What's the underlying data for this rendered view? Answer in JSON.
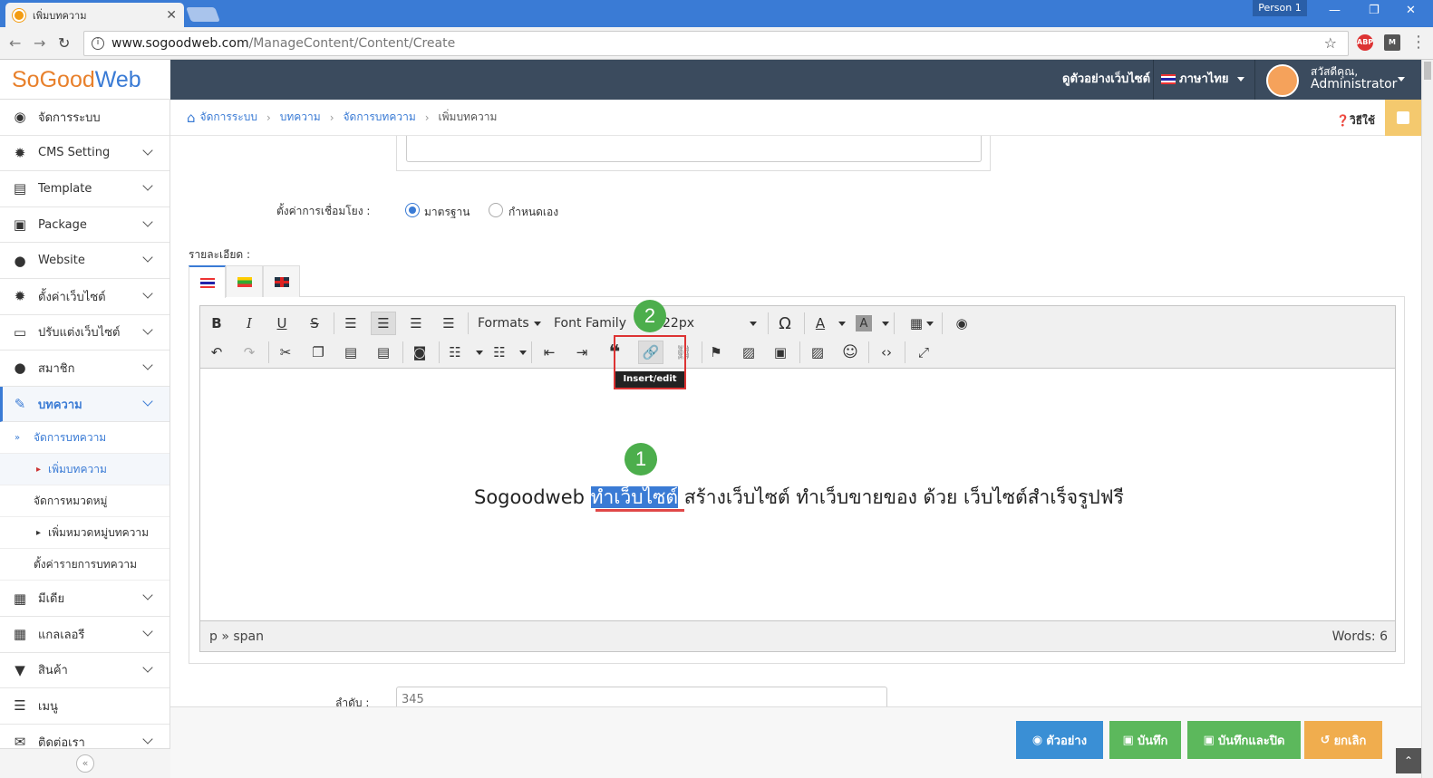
{
  "browser": {
    "tab_title": "เพิ่มบทความ",
    "person": "Person 1",
    "url_host": "www.sogoodweb.com",
    "url_path": "/ManageContent/Content/Create",
    "ext_abp": "ABP",
    "ext_m": "M"
  },
  "brand": {
    "part1": "SoGo",
    "part2": "od",
    "part3": "Web"
  },
  "header": {
    "preview_site": "ดูตัวอย่างเว็บไซต์",
    "language": "ภาษาไทย",
    "greeting": "สวัสดีคุณ,",
    "username": "Administrator"
  },
  "sidebar": {
    "items": [
      {
        "label": "จัดการระบบ",
        "icon": "dashboard-icon"
      },
      {
        "label": "CMS Setting",
        "icon": "gear-icon"
      },
      {
        "label": "Template",
        "icon": "template-icon"
      },
      {
        "label": "Package",
        "icon": "gift-icon"
      },
      {
        "label": "Website",
        "icon": "globe-icon"
      },
      {
        "label": "ตั้งค่าเว็บไซต์",
        "icon": "gear-icon"
      },
      {
        "label": "ปรับแต่งเว็บไซต์",
        "icon": "monitor-icon"
      },
      {
        "label": "สมาชิก",
        "icon": "user-icon"
      },
      {
        "label": "บทความ",
        "icon": "edit-icon"
      }
    ],
    "subitems": [
      "จัดการบทความ",
      "เพิ่มบทความ",
      "จัดการหมวดหมู่",
      "เพิ่มหมวดหมู่บทความ",
      "ตั้งค่ารายการบทความ"
    ],
    "items2": [
      {
        "label": "มีเดีย",
        "icon": "film-icon"
      },
      {
        "label": "แกลเลอรี",
        "icon": "grid-icon"
      },
      {
        "label": "สินค้า",
        "icon": "cart-icon"
      },
      {
        "label": "เมนู",
        "icon": "menu-icon"
      },
      {
        "label": "ติดต่อเรา",
        "icon": "mail-icon"
      }
    ]
  },
  "breadcrumb": [
    "จัดการระบบ",
    "บทความ",
    "จัดการบทความ",
    "เพิ่มบทความ"
  ],
  "help": "วิธีใช้",
  "form": {
    "link_setting_label": "ตั้งค่าการเชื่อมโยง :",
    "radio_standard": "มาตรฐาน",
    "radio_custom": "กำหนดเอง",
    "detail_label": "รายละเอียด :",
    "order_label": "ลำดับ :",
    "order_placeholder": "345"
  },
  "editor": {
    "formats": "Formats",
    "font_family": "Font Family",
    "font_size": "22px",
    "tooltip": "Insert/edit link",
    "text_before": "Sogoodweb ",
    "text_highlight": "ทำเว็บไซต์",
    "text_after": " สร้างเว็บไซต์ ทำเว็บขายของ ด้วย เว็บไซต์สำเร็จรูปฟรี",
    "path": "p » span",
    "words": "Words: 6",
    "badge1": "1",
    "badge2": "2"
  },
  "footer": {
    "preview": "ตัวอย่าง",
    "save": "บันทึก",
    "save_close": "บันทึกและปิด",
    "cancel": "ยกเลิก",
    "colors": {
      "preview": "#3a8fd5",
      "save": "#5cb85c",
      "save_close": "#5cb85c",
      "cancel": "#f0ad4e"
    }
  }
}
